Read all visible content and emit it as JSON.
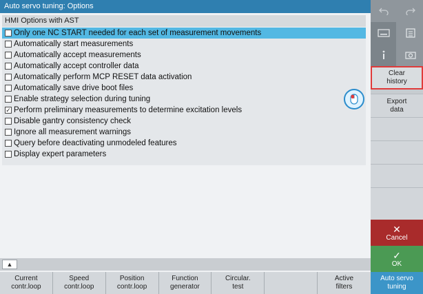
{
  "window": {
    "title": "Auto servo tuning: Options"
  },
  "section": {
    "header": "HMI Options with AST"
  },
  "options": [
    {
      "label": "Only one NC START needed for each set of measurement movements",
      "checked": false,
      "selected": true
    },
    {
      "label": "Automatically start measurements",
      "checked": false
    },
    {
      "label": "Automatically accept measurements",
      "checked": false
    },
    {
      "label": "Automatically accept controller data",
      "checked": false
    },
    {
      "label": "Automatically perform MCP RESET data activation",
      "checked": false
    },
    {
      "label": "Automatically save drive boot files",
      "checked": false
    },
    {
      "label": "Enable strategy selection during tuning",
      "checked": false
    },
    {
      "label": "Perform preliminary measurements to determine excitation levels",
      "checked": true
    },
    {
      "label": "Disable gantry consistency check",
      "checked": false
    },
    {
      "label": "Ignore all measurement warnings",
      "checked": false
    },
    {
      "label": "Query before deactivating unmodeled features",
      "checked": false
    },
    {
      "label": "Display expert parameters",
      "checked": false
    }
  ],
  "scroll": {
    "up_glyph": "▲"
  },
  "bottom_softkeys": [
    "Current\ncontr.loop",
    "Speed\ncontr.loop",
    "Position\ncontr.loop",
    "Function\ngenerator",
    "Circular.\ntest",
    "",
    "Active\nfilters"
  ],
  "vertical_softkeys": {
    "top_icons": [
      "undo-icon",
      "redo-icon",
      "keyboard-icon",
      "calculator-icon",
      "info-icon",
      "camera-icon"
    ],
    "clear_history": "Clear\nhistory",
    "export_data": "Export\ndata",
    "cancel": "Cancel",
    "ok": "OK",
    "auto_servo_tuning": "Auto servo\ntuning"
  },
  "colors": {
    "titlebar": "#2f7fb0",
    "selected_row": "#53b8e3",
    "cancel": "#a92b2b",
    "ok": "#4b9a54",
    "active_mode": "#3c95c8",
    "highlight_border": "#e03a3a"
  }
}
